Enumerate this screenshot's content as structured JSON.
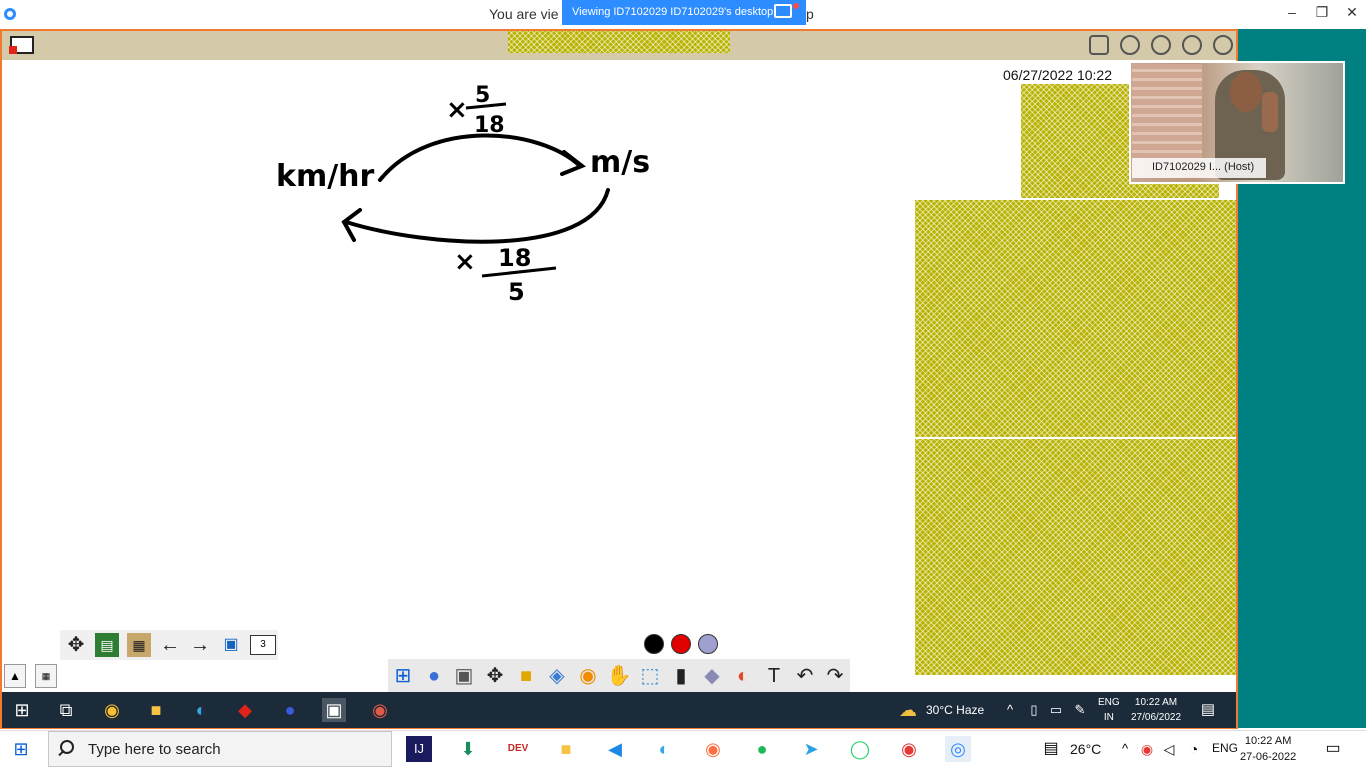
{
  "zoom": {
    "viewing_prefix": "You are vie",
    "viewing_suffix": "p",
    "viewing_badge": "Viewing ID7102029 ID7102029's desktop",
    "minimize": "–",
    "restore": "❐",
    "close": "✕"
  },
  "whiteboard": {
    "date": "06/27/2022  10:22",
    "drawing": {
      "left_unit": "km/hr",
      "right_unit": "m/s",
      "top_factor_prefix": "×",
      "top_numerator": "5",
      "top_denominator": "18",
      "bottom_factor_prefix": "×",
      "bottom_numerator": "18",
      "bottom_denominator": "5"
    },
    "page_number": "3"
  },
  "video": {
    "host_label": "ID7102029 I...  (Host)"
  },
  "colors": {
    "black": "#000000",
    "red": "#e00000",
    "lavender": "#a0a0d0",
    "accent": "#2d8cff",
    "frame": "#f07b2e",
    "teal": "#008080"
  },
  "inner_taskbar": {
    "weather": "30°C  Haze",
    "lang_line1": "ENG",
    "lang_line2": "IN",
    "time": "10:22 AM",
    "date": "27/06/2022"
  },
  "outer_taskbar": {
    "search_placeholder": "Type here to search",
    "temperature": "26°C",
    "lang": "ENG",
    "time": "10:22 AM",
    "date": "27-06-2022"
  }
}
